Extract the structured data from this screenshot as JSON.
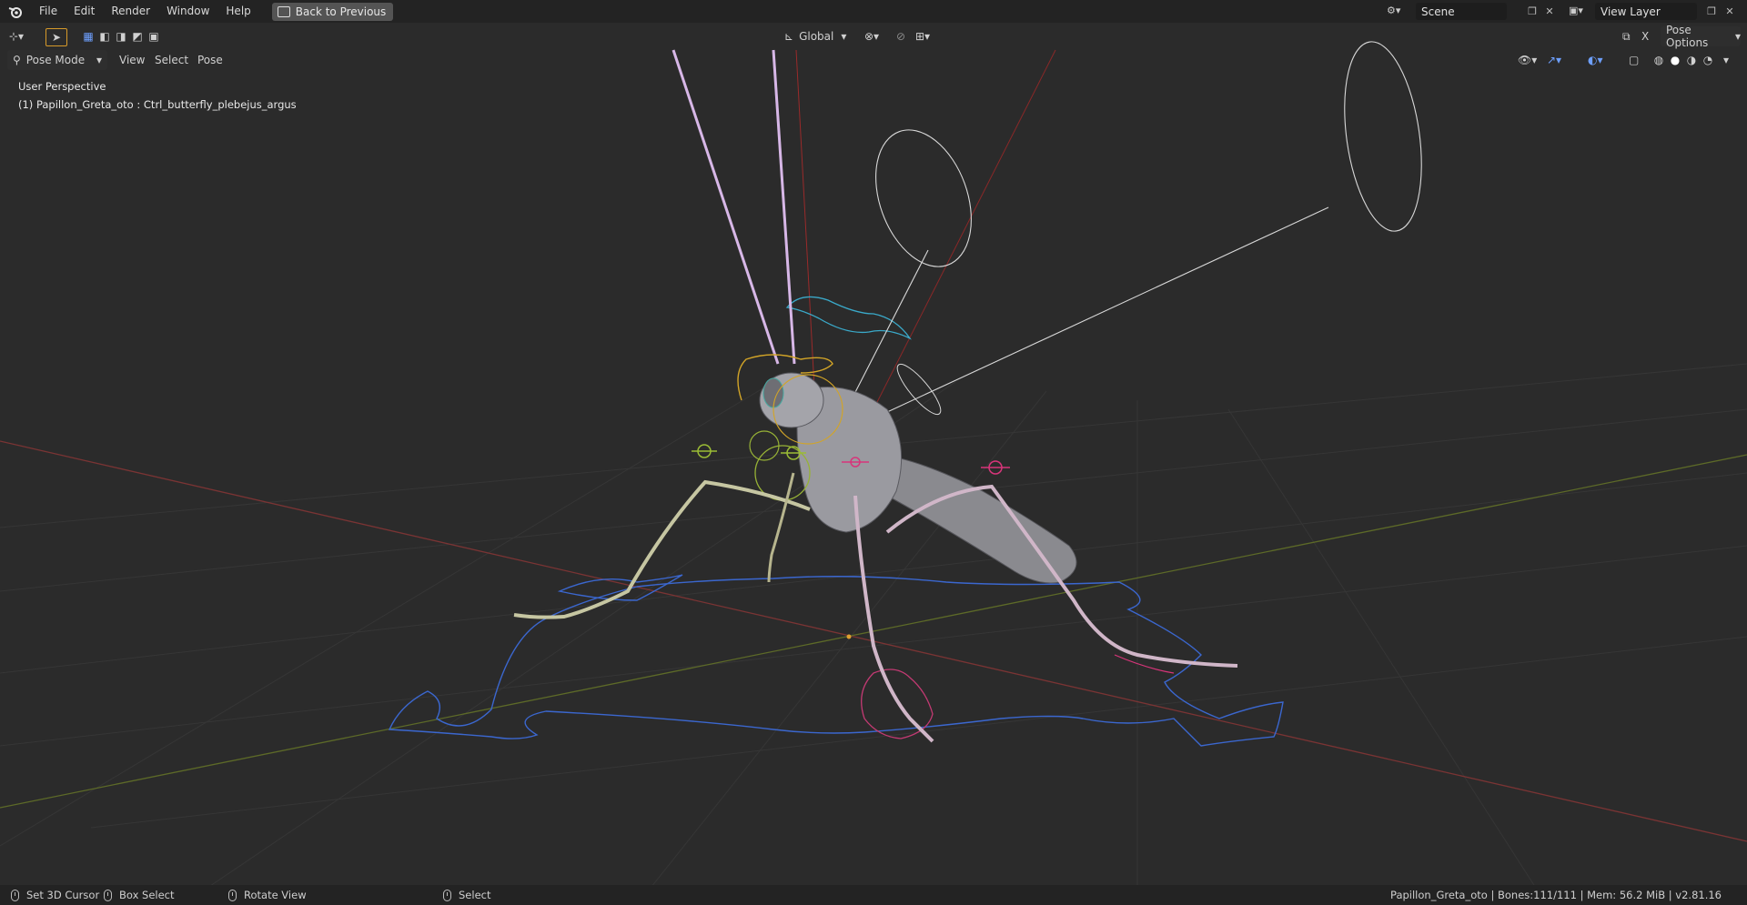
{
  "topbar": {
    "menus": [
      "File",
      "Edit",
      "Render",
      "Window",
      "Help"
    ],
    "back_button": "Back to Previous",
    "scene_name": "Scene",
    "view_layer": "View Layer"
  },
  "header": {
    "mode": "Pose Mode",
    "menus": [
      "View",
      "Select",
      "Pose"
    ],
    "transform_orientation": "Global",
    "pose_options": "Pose Options",
    "x_mirror": "X"
  },
  "viewport": {
    "perspective": "User Perspective",
    "object_info": "(1) Papillon_Greta_oto : Ctrl_butterfly_plebejus_argus"
  },
  "statusbar": {
    "left_click": "Set 3D Cursor",
    "drag": "Box Select",
    "middle": "Rotate View",
    "right": "Select",
    "info": "Papillon_Greta_oto | Bones:111/111 | Mem: 56.2 MiB | v2.81.16"
  },
  "colors": {
    "background": "#2b2b2b",
    "x_axis": "#8a3b3b",
    "y_axis": "#6b7a2e",
    "bone_blue": "#3f6fd8",
    "bone_yellow": "#b8c43a",
    "bone_pink": "#d03a78"
  }
}
